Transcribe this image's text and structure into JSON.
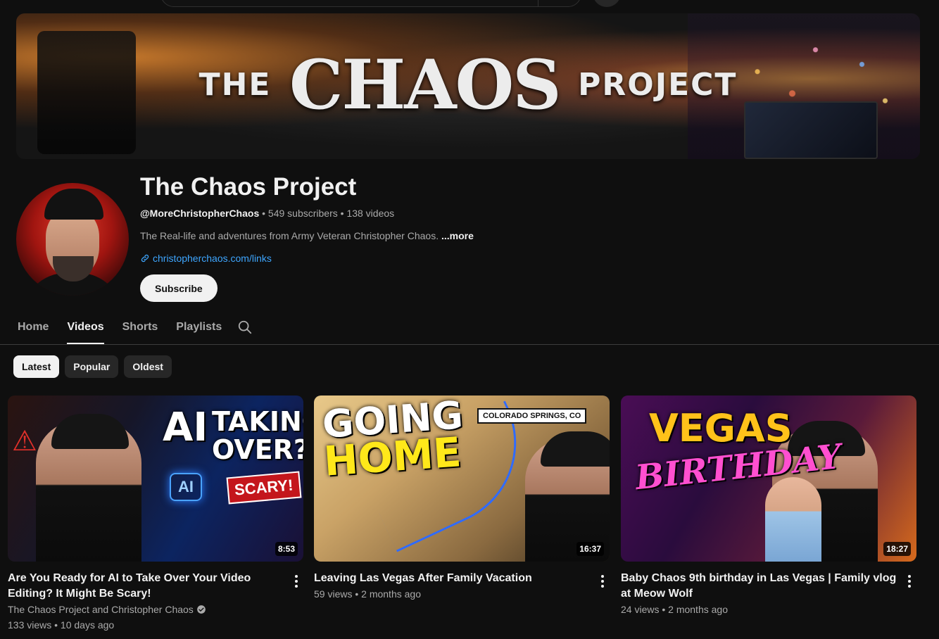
{
  "banner": {
    "title_left": "THE",
    "title_main": "CHAOS",
    "title_right": "PROJECT"
  },
  "channel": {
    "name": "The Chaos Project",
    "handle": "@MoreChristopherChaos",
    "subscribers": "549 subscribers",
    "videos_count": "138 videos",
    "separator": "•",
    "description": "The Real-life and adventures from Army Veteran Christopher Chaos.",
    "more_label": "...more",
    "link": "christopherchaos.com/links",
    "subscribe_label": "Subscribe"
  },
  "tabs": [
    {
      "label": "Home"
    },
    {
      "label": "Videos"
    },
    {
      "label": "Shorts"
    },
    {
      "label": "Playlists"
    }
  ],
  "chips": [
    {
      "label": "Latest"
    },
    {
      "label": "Popular"
    },
    {
      "label": "Oldest"
    }
  ],
  "videos": [
    {
      "title": "Are You Ready for AI to Take Over Your Video Editing? It Might Be Scary!",
      "channel": "The Chaos Project and Christopher Chaos",
      "stats": "133 views • 10 days ago",
      "duration": "8:53",
      "thumb_text_a": "AI",
      "thumb_text_b": "TAKING OVER?",
      "thumb_badge": "AI",
      "thumb_tag": "SCARY!"
    },
    {
      "title": "Leaving Las Vegas After Family Vacation",
      "stats": "59 views • 2 months ago",
      "duration": "16:37",
      "thumb_text_a": "GOING",
      "thumb_text_b": "HOME",
      "thumb_tag": "COLORADO SPRINGS, CO"
    },
    {
      "title": "Baby Chaos 9th birthday in Las Vegas | Family vlog at Meow Wolf",
      "stats": "24 views • 2 months ago",
      "duration": "18:27",
      "thumb_text_a": "VEGAS",
      "thumb_text_b": "BIRTHDAY"
    }
  ]
}
